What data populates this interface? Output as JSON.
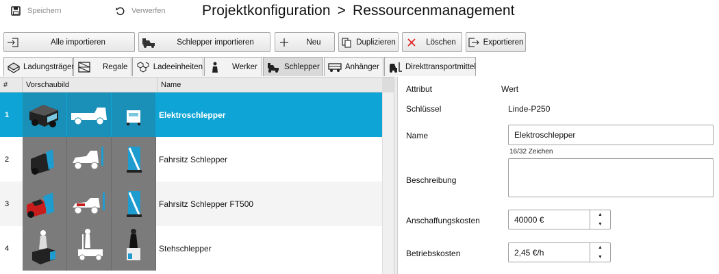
{
  "header": {
    "save_label": "Speichern",
    "discard_label": "Verwerfen",
    "breadcrumb_root": "Projektkonfiguration",
    "breadcrumb_sep": ">",
    "breadcrumb_current": "Ressourcenmanagement"
  },
  "toolbar": {
    "import_all": "Alle importieren",
    "import_tugger": "Schlepper importieren",
    "new": "Neu",
    "duplicate": "Duplizieren",
    "delete": "Löschen",
    "export": "Exportieren"
  },
  "tabs": [
    {
      "label": "Ladungsträger",
      "icon": "pallet-icon"
    },
    {
      "label": "Regale",
      "icon": "shelf-icon"
    },
    {
      "label": "Ladeeinheiten",
      "icon": "boxes-icon"
    },
    {
      "label": "Werker",
      "icon": "worker-icon"
    },
    {
      "label": "Schlepper",
      "icon": "tugger-icon"
    },
    {
      "label": "Anhänger",
      "icon": "trailer-icon"
    },
    {
      "label": "Direkttransportmittel",
      "icon": "forklift-icon"
    }
  ],
  "active_tab": "Schlepper",
  "table": {
    "columns": [
      "#",
      "Vorschaubild",
      "Name"
    ],
    "rows": [
      {
        "num": "1",
        "name": "Elektroschlepper",
        "selected": true
      },
      {
        "num": "2",
        "name": "Fahrsitz Schlepper",
        "selected": false
      },
      {
        "num": "3",
        "name": "Fahrsitz Schlepper FT500",
        "selected": false
      },
      {
        "num": "4",
        "name": "Stehschlepper",
        "selected": false
      }
    ]
  },
  "properties": {
    "header_attribute": "Attribut",
    "header_value": "Wert",
    "key_label": "Schlüssel",
    "key_value": "Linde-P250",
    "name_label": "Name",
    "name_value": "Elektroschlepper",
    "name_hint": "16/32 Zeichen",
    "description_label": "Beschreibung",
    "description_value": "",
    "acq_cost_label": "Anschaffungskosten",
    "acq_cost_value": "40000 €",
    "op_cost_label": "Betriebskosten",
    "op_cost_value": "2,45 €/h"
  },
  "colors": {
    "selection": "#0ea5d6",
    "thumb_background": "#7b7b7b",
    "delete_icon": "#e02020"
  }
}
